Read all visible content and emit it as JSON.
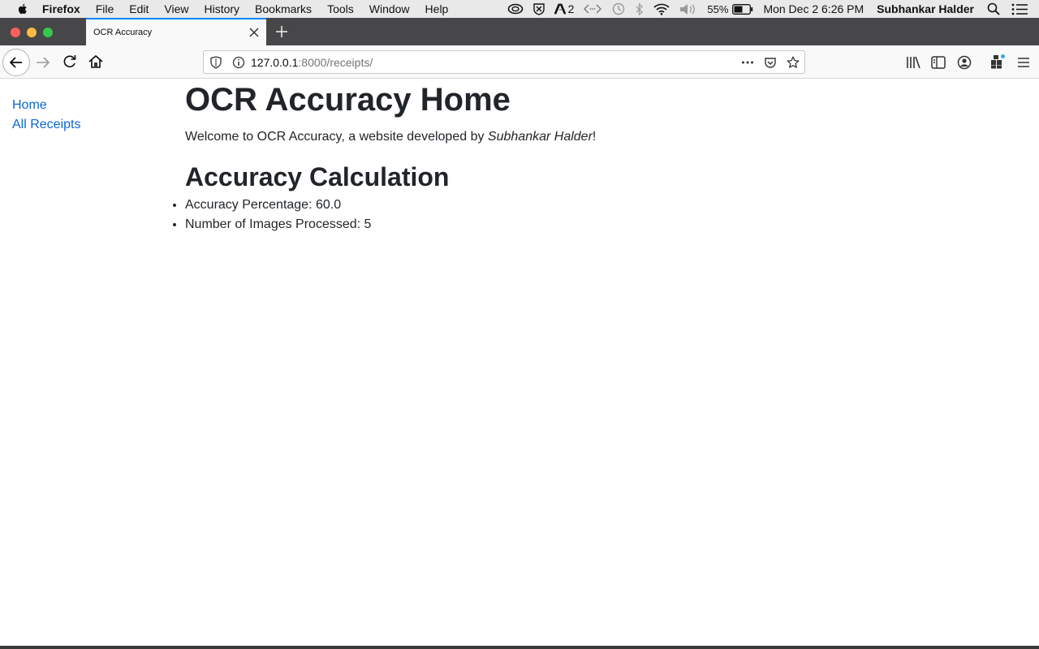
{
  "menubar": {
    "app_name": "Firefox",
    "items": [
      "File",
      "Edit",
      "View",
      "History",
      "Bookmarks",
      "Tools",
      "Window",
      "Help"
    ],
    "adobe_count": "2",
    "battery": "55%",
    "datetime": "Mon Dec 2  6:26 PM",
    "user": "Subhankar Halder"
  },
  "browser": {
    "tab_title": "OCR Accuracy",
    "url_host": "127.0.0.1",
    "url_rest": ":8000/receipts/",
    "accent": "#0a84ff"
  },
  "sidebar": {
    "links": [
      {
        "label": "Home"
      },
      {
        "label": "All Receipts"
      }
    ],
    "link_color": "#0a66d8"
  },
  "main": {
    "title": "OCR Accuracy Home",
    "welcome_prefix": "Welcome to OCR Accuracy, a website developed by ",
    "author": "Subhankar Halder",
    "welcome_suffix": "!",
    "section_title": "Accuracy Calculation",
    "stats": [
      {
        "label": "Accuracy Percentage: 60.0"
      },
      {
        "label": "Number of Images Processed: 5"
      }
    ]
  }
}
